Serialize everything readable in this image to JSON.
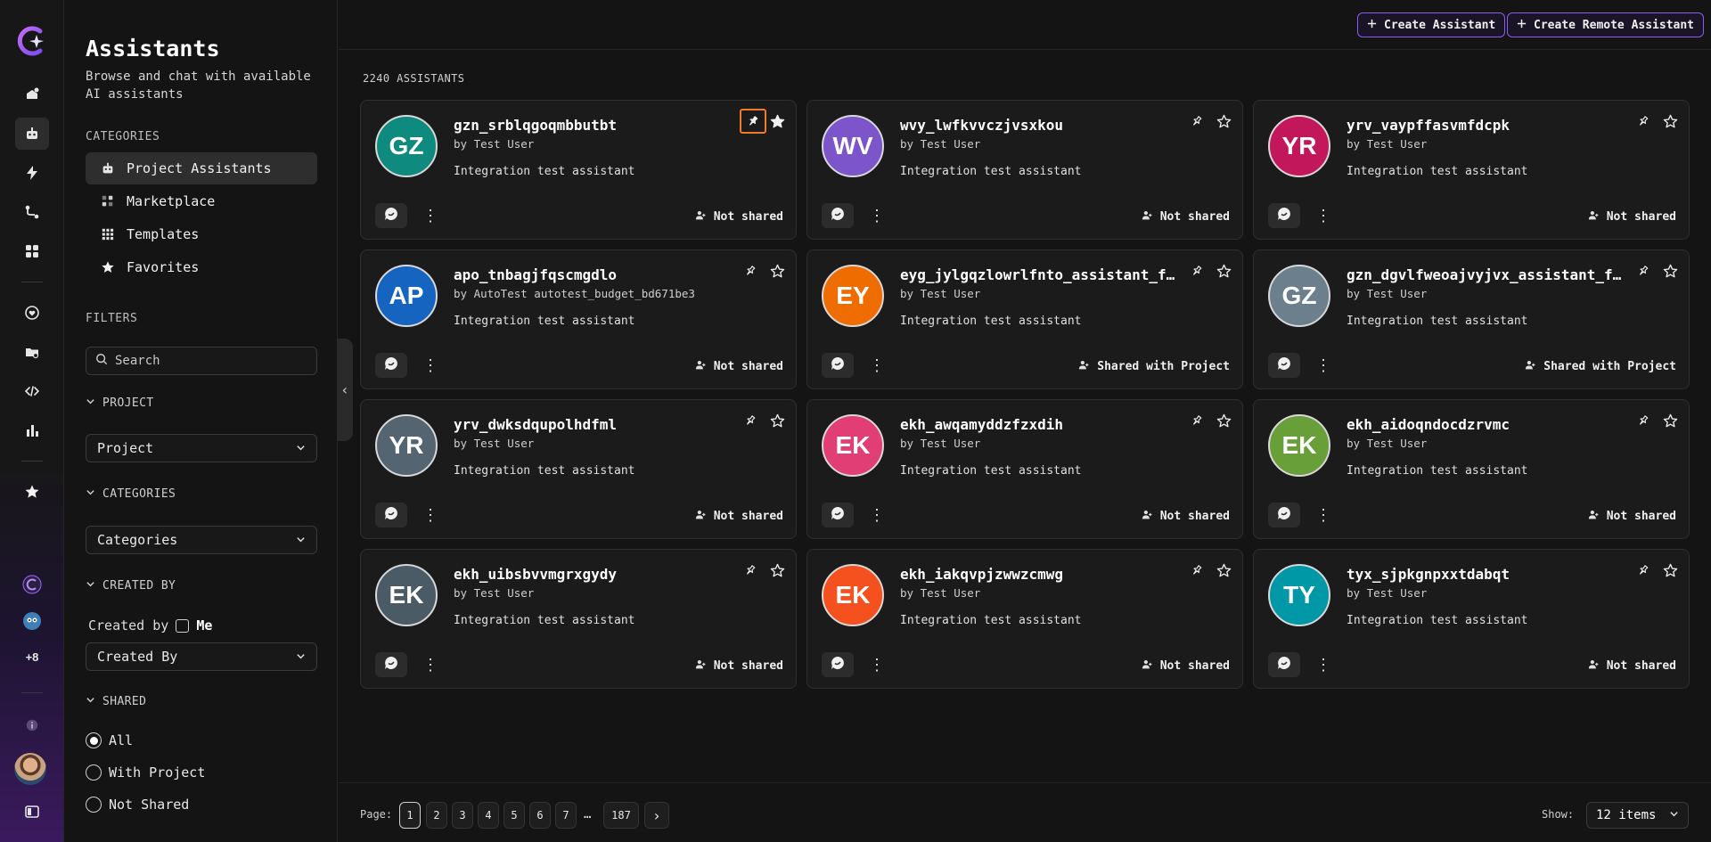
{
  "rail": {
    "more_label": "+8",
    "items": [
      "new-chat-icon",
      "robot-icon",
      "bolt-icon",
      "workflow-icon",
      "apps-icon",
      "heart-icon",
      "folder-icon",
      "code-icon",
      "chart-icon",
      "star-icon"
    ]
  },
  "sidebar": {
    "title": "Assistants",
    "subtitle": "Browse and chat with available AI assistants",
    "categories_heading": "CATEGORIES",
    "categories": [
      {
        "label": "Project Assistants",
        "icon": "robot-icon",
        "active": true
      },
      {
        "label": "Marketplace",
        "icon": "marketplace-icon",
        "active": false
      },
      {
        "label": "Templates",
        "icon": "grid-icon",
        "active": false
      },
      {
        "label": "Favorites",
        "icon": "star-icon",
        "active": false
      }
    ],
    "filters_heading": "FILTERS",
    "search_placeholder": "Search",
    "project_heading": "PROJECT",
    "project_select": "Project",
    "categories_filter_heading": "CATEGORIES",
    "categories_select": "Categories",
    "created_by_heading": "CREATED BY",
    "created_by_label": "Created by",
    "me_label": "Me",
    "created_by_select": "Created By",
    "shared_heading": "SHARED",
    "shared_options": [
      {
        "label": "All",
        "selected": true
      },
      {
        "label": "With Project",
        "selected": false
      },
      {
        "label": "Not Shared",
        "selected": false
      }
    ]
  },
  "toolbar": {
    "create_assistant": "Create Assistant",
    "create_remote_assistant": "Create Remote Assistant"
  },
  "assistants_count": "2240 ASSISTANTS",
  "cards": [
    {
      "initials": "GZ",
      "color": "#0f8a7e",
      "name": "gzn_srblqgoqmbbutbt",
      "by": "by Test User",
      "desc": "Integration test assistant",
      "share": "Not shared",
      "pinned": true,
      "starred": true
    },
    {
      "initials": "WV",
      "color": "#7b55c9",
      "name": "wvy_lwfkvvczjvsxkou",
      "by": "by Test User",
      "desc": "Integration test assistant",
      "share": "Not shared",
      "pinned": false,
      "starred": false
    },
    {
      "initials": "YR",
      "color": "#c2185b",
      "name": "yrv_vaypffasvmfdcpk",
      "by": "by Test User",
      "desc": "Integration test assistant",
      "share": "Not shared",
      "pinned": false,
      "starred": false
    },
    {
      "initials": "AP",
      "color": "#1565c0",
      "name": "apo_tnbagjfqscmgdlo",
      "by": "by AutoTest autotest_budget_bd671be3",
      "desc": "Integration test assistant",
      "share": "Not shared",
      "pinned": false,
      "starred": false
    },
    {
      "initials": "EY",
      "color": "#ef6c00",
      "name": "eyg_jylgqzlowrlfnto_assistant_f…",
      "by": "by Test User",
      "desc": "Integration test assistant",
      "share": "Shared with Project",
      "pinned": false,
      "starred": false
    },
    {
      "initials": "GZ",
      "color": "#6b7f8c",
      "name": "gzn_dgvlfweoajvyjvx_assistant_f…",
      "by": "by Test User",
      "desc": "Integration test assistant",
      "share": "Shared with Project",
      "pinned": false,
      "starred": false
    },
    {
      "initials": "YR",
      "color": "#546470",
      "name": "yrv_dwksdqupolhdfml",
      "by": "by Test User",
      "desc": "Integration test assistant",
      "share": "Not shared",
      "pinned": false,
      "starred": false
    },
    {
      "initials": "EK",
      "color": "#e03e74",
      "name": "ekh_awqamyddzfzxdih",
      "by": "by Test User",
      "desc": "Integration test assistant",
      "share": "Not shared",
      "pinned": false,
      "starred": false
    },
    {
      "initials": "EK",
      "color": "#689f38",
      "name": "ekh_aidoqndocdzrvmc",
      "by": "by Test User",
      "desc": "Integration test assistant",
      "share": "Not shared",
      "pinned": false,
      "starred": false
    },
    {
      "initials": "EK",
      "color": "#4b5b66",
      "name": "ekh_uibsbvvmgrxgydy",
      "by": "by Test User",
      "desc": "Integration test assistant",
      "share": "Not shared",
      "pinned": false,
      "starred": false
    },
    {
      "initials": "EK",
      "color": "#f4511e",
      "name": "ekh_iakqvpjzwwzcmwg",
      "by": "by Test User",
      "desc": "Integration test assistant",
      "share": "Not shared",
      "pinned": false,
      "starred": false
    },
    {
      "initials": "TY",
      "color": "#0097a7",
      "name": "tyx_sjpkgnpxxtdabqt",
      "by": "by Test User",
      "desc": "Integration test assistant",
      "share": "Not shared",
      "pinned": false,
      "starred": false
    }
  ],
  "pagination": {
    "label": "Page:",
    "pages": [
      "1",
      "2",
      "3",
      "4",
      "5",
      "6",
      "7"
    ],
    "current": "1",
    "ellipsis": "…",
    "last": "187",
    "next": "›",
    "show_label": "Show:",
    "show_value": "12 items"
  },
  "colors": {
    "accent": "#8a5cf0",
    "focus": "#f07a2a"
  }
}
